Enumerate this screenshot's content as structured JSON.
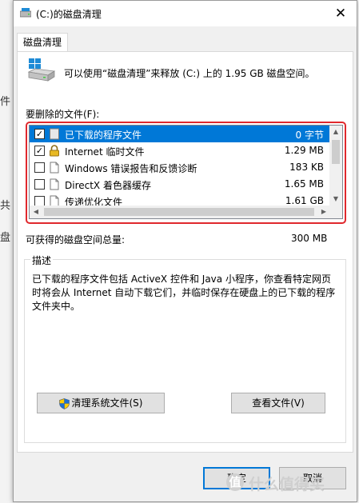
{
  "background": {
    "chars": [
      "件",
      "共",
      "盘"
    ]
  },
  "window": {
    "title": "(C:)的磁盘清理",
    "close_glyph": "✕",
    "tab_label": "磁盘清理"
  },
  "info": {
    "text": "可以使用“磁盘清理”来释放 (C:) 上的 1.95 GB 磁盘空间。"
  },
  "files_label": "要删除的文件(F):",
  "files": [
    {
      "checked": true,
      "icon": "blank-file-icon",
      "name": "已下载的程序文件",
      "size": "0 字节",
      "selected": true
    },
    {
      "checked": true,
      "icon": "lock-icon",
      "name": "Internet 临时文件",
      "size": "1.29 MB",
      "selected": false
    },
    {
      "checked": false,
      "icon": "file-icon",
      "name": "Windows 错误报告和反馈诊断",
      "size": "183 KB",
      "selected": false
    },
    {
      "checked": false,
      "icon": "file-icon",
      "name": "DirectX 着色器缓存",
      "size": "1.65 MB",
      "selected": false
    },
    {
      "checked": false,
      "icon": "file-icon",
      "name": "传递优化文件",
      "size": "1.61 GB",
      "selected": false
    }
  ],
  "space": {
    "label": "可获得的磁盘空间总量:",
    "value": "300 MB"
  },
  "description": {
    "title": "描述",
    "text": "已下载的程序文件包括 ActiveX 控件和 Java 小程序，你查看特定网页时将会从 Internet 自动下载它们，并临时保存在硬盘上的已下载的程序文件夹中。"
  },
  "buttons": {
    "clean_system": "清理系统文件(S)",
    "view_files": "查看文件(V)",
    "ok": "确定",
    "cancel": "取消"
  },
  "watermark": {
    "glyph": "值",
    "text": "什么值得买"
  },
  "colors": {
    "selection": "#0078d7",
    "highlight_border": "#e0282d"
  }
}
